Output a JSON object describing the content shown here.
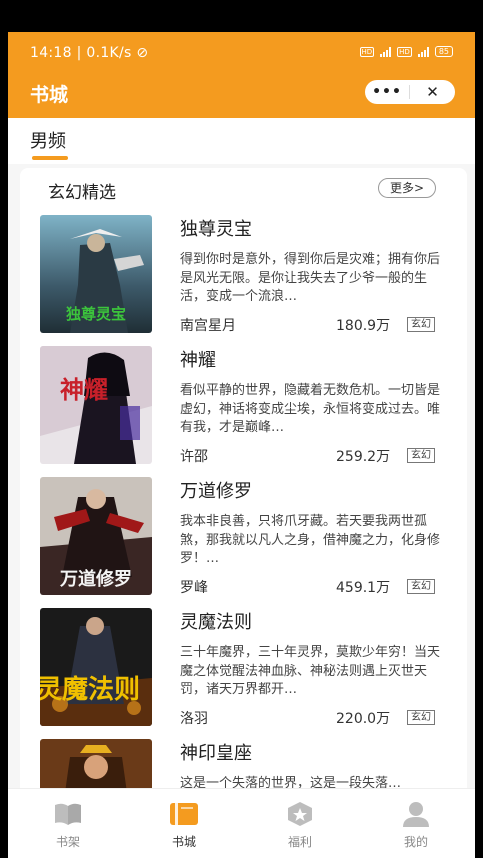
{
  "status_bar": {
    "time": "14:18",
    "speed": "0.1K/s",
    "battery": "85"
  },
  "header": {
    "title": "书城",
    "more_icon": "•••",
    "close_icon": "✕"
  },
  "tab": {
    "label": "男频"
  },
  "section": {
    "title": "玄幻精选",
    "more_label": "更多>"
  },
  "books": [
    {
      "title": "独尊灵宝",
      "desc": "得到你时是意外，得到你后是灾难；拥有你后是风光无限。是你让我失去了少爷一般的生活，变成一个流浪…",
      "author": "南宫星月",
      "words": "180.9万",
      "tag": "玄幻",
      "cover_text": "独尊灵宝"
    },
    {
      "title": "神耀",
      "desc": "看似平静的世界，隐藏着无数危机。一切皆是虚幻，神话将变成尘埃，永恒将变成过去。唯有我，才是巅峰…",
      "author": "许邵",
      "words": "259.2万",
      "tag": "玄幻",
      "cover_text": "神耀"
    },
    {
      "title": "万道修罗",
      "desc": "我本非良善，只将爪牙藏。若天要我两世孤煞，那我就以凡人之身，借神魔之力，化身修罗！…",
      "author": "罗峰",
      "words": "459.1万",
      "tag": "玄幻",
      "cover_text": "万道修罗"
    },
    {
      "title": "灵魔法则",
      "desc": "三十年魔界，三十年灵界，莫欺少年穷！当天魔之体觉醒法神血脉、神秘法则遇上灭世天罚，诸天万界都开…",
      "author": "洛羽",
      "words": "220.0万",
      "tag": "玄幻",
      "cover_text": "灵魔法则"
    },
    {
      "title": "神印皇座",
      "desc": "这是一个失落的世界，这是一段失落…",
      "author": "",
      "words": "",
      "tag": "",
      "cover_text": ""
    }
  ],
  "nav": [
    {
      "label": "书架",
      "icon": "book-open-icon"
    },
    {
      "label": "书城",
      "icon": "bookstore-icon"
    },
    {
      "label": "福利",
      "icon": "star-badge-icon"
    },
    {
      "label": "我的",
      "icon": "user-icon"
    }
  ],
  "colors": {
    "accent": "#f49b1f"
  }
}
